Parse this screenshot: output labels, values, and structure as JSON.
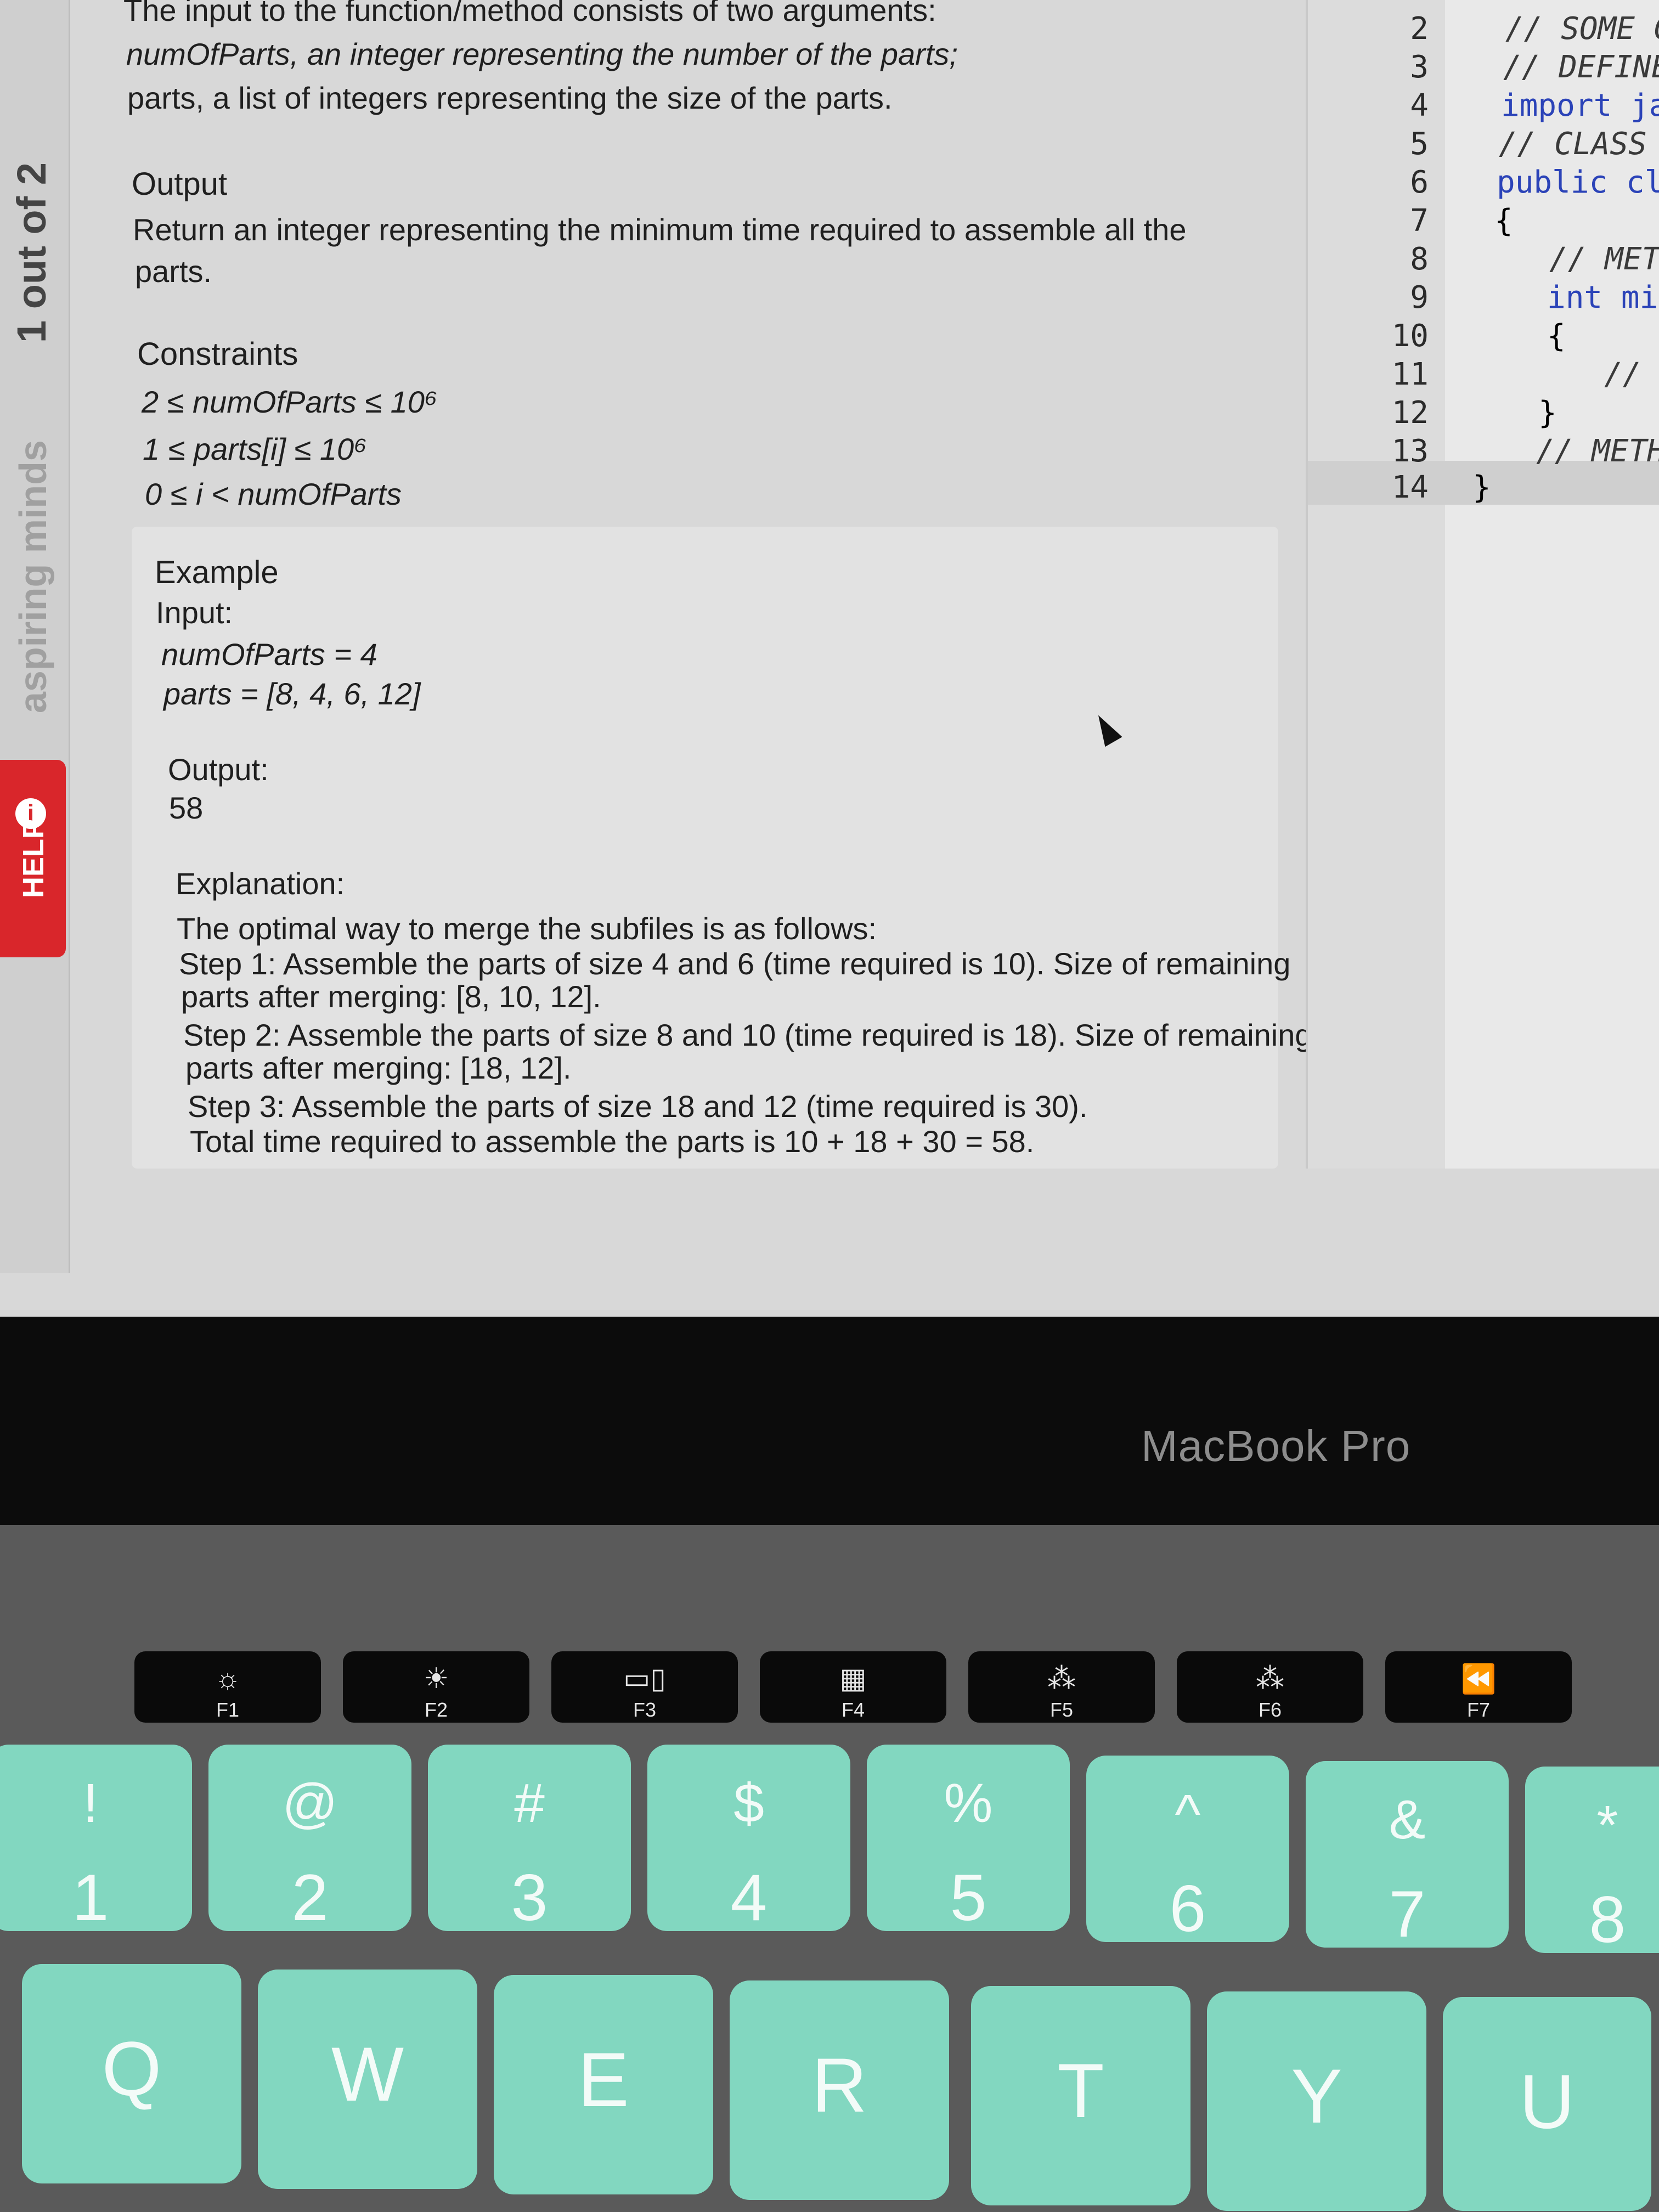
{
  "sidebar": {
    "pages_text": "1 out of 2",
    "brand_text": "aspiring minds",
    "help_label": "HELP",
    "help_icon": "info-icon"
  },
  "problem": {
    "input_lines": [
      "The input to the function/method consists of two arguments:",
      "numOfParts, an integer representing the number of the parts;",
      "parts, a list of integers representing the size of the parts."
    ],
    "output_heading": "Output",
    "output_lines": [
      "Return an integer representing the minimum time required to assemble all the",
      "parts."
    ],
    "constraints_heading": "Constraints",
    "constraints": [
      "2 ≤ numOfParts ≤ 10⁶",
      "1 ≤ parts[i] ≤ 10⁶",
      "0 ≤ i < numOfParts"
    ],
    "example_heading": "Example",
    "example_input_label": "Input:",
    "example_input_lines": [
      "numOfParts = 4",
      "parts = [8, 4, 6, 12]"
    ],
    "example_output_label": "Output:",
    "example_output_value": "58",
    "explanation_label": "Explanation:",
    "explanation_lines": [
      "The optimal way to merge the subfiles is as follows:",
      "Step 1: Assemble the parts of size 4 and 6 (time required is 10). Size of remaining",
      "parts after merging: [8, 10, 12].",
      "Step 2: Assemble the parts of size 8 and 10 (time required is 18). Size of remaining",
      "parts after merging: [18, 12].",
      "Step 3: Assemble the parts of size 18 and 12 (time required is 30).",
      "Total time required to assemble the parts is 10 + 18 + 30 = 58."
    ]
  },
  "editor": {
    "lines": [
      {
        "num": "2",
        "code": "// SOME CL"
      },
      {
        "num": "3",
        "code": "// DEFINE"
      },
      {
        "num": "4",
        "code": "import jav"
      },
      {
        "num": "5",
        "code": "// CLASS B"
      },
      {
        "num": "6",
        "code": "public cla"
      },
      {
        "num": "7",
        "code": "{"
      },
      {
        "num": "8",
        "code": "// METH"
      },
      {
        "num": "9",
        "code": "int min"
      },
      {
        "num": "10",
        "code": "{"
      },
      {
        "num": "11",
        "code": "// I"
      },
      {
        "num": "12",
        "code": "}"
      },
      {
        "num": "13",
        "code": "// METHO"
      },
      {
        "num": "14",
        "code": "}"
      }
    ]
  },
  "laptop": {
    "brand": "MacBook Pro"
  },
  "function_keys": [
    {
      "label": "F1",
      "icon": "brightness-down-icon"
    },
    {
      "label": "F2",
      "icon": "brightness-up-icon"
    },
    {
      "label": "F3",
      "icon": "mission-control-icon"
    },
    {
      "label": "F4",
      "icon": "launchpad-icon"
    },
    {
      "label": "F5",
      "icon": "keyboard-light-down-icon"
    },
    {
      "label": "F6",
      "icon": "keyboard-light-up-icon"
    },
    {
      "label": "F7",
      "icon": "rewind-icon"
    }
  ],
  "number_keys": [
    {
      "top": "!",
      "bottom": "1"
    },
    {
      "top": "@",
      "bottom": "2"
    },
    {
      "top": "#",
      "bottom": "3"
    },
    {
      "top": "$",
      "bottom": "4"
    },
    {
      "top": "%",
      "bottom": "5"
    },
    {
      "top": "^",
      "bottom": "6"
    },
    {
      "top": "&",
      "bottom": "7"
    },
    {
      "top": "*",
      "bottom": "8"
    }
  ],
  "letter_keys": [
    "Q",
    "W",
    "E",
    "R",
    "T",
    "Y",
    "U"
  ]
}
